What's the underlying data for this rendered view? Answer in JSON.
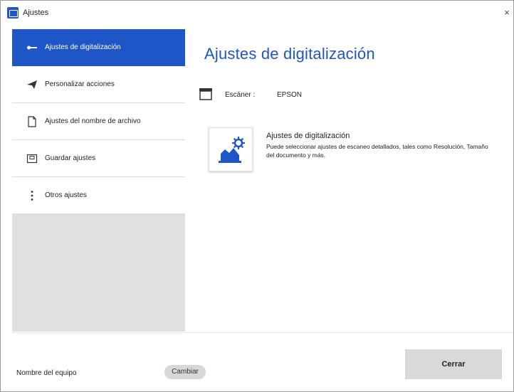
{
  "window": {
    "title": "Ajustes",
    "close_glyph": "×"
  },
  "sidebar": {
    "items": [
      {
        "label": "Ajustes de digitalización",
        "icon": "scan-settings-icon",
        "active": true
      },
      {
        "label": "Personalizar acciones",
        "icon": "send-icon",
        "active": false
      },
      {
        "label": "Ajustes del nombre de archivo",
        "icon": "document-icon",
        "active": false
      },
      {
        "label": "Guardar ajustes",
        "icon": "save-settings-icon",
        "active": false
      },
      {
        "label": "Otros ajustes",
        "icon": "more-vertical-icon",
        "active": false
      }
    ]
  },
  "main": {
    "title": "Ajustes de digitalización",
    "scanner_label": "Escáner :",
    "scanner_value": "EPSON",
    "option": {
      "title": "Ajustes de digitalización",
      "description": "Puede seleccionar ajustes de escaneo detallados, tales como Resolución, Tamaño del documento y más."
    }
  },
  "footer": {
    "pc_name_label": "Nombre del equipo",
    "change_label": "Cambiar",
    "close_label": "Cerrar"
  },
  "colors": {
    "accent": "#1e56c8",
    "sidebar_bg": "#e0e0e0",
    "button_bg": "#d9d9d9"
  }
}
